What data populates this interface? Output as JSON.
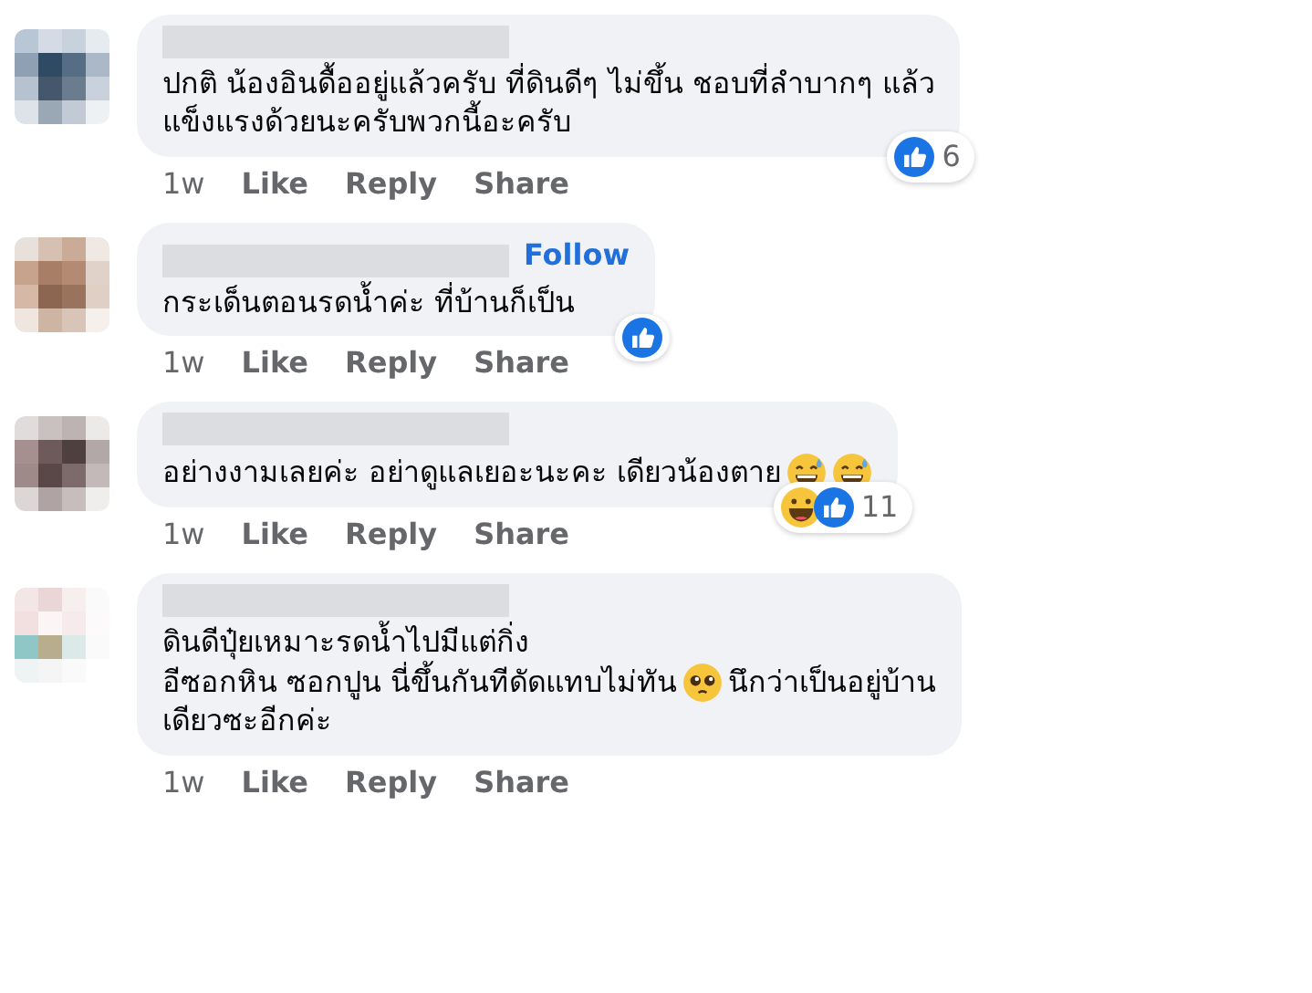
{
  "comments": [
    {
      "lines": [
        [
          {
            "kind": "text",
            "text": "ปกติ น้องอินดื้ออยู่แล้วครับ ที่ดินดีๆ ไม่ขึ้น ชอบที่ลำบากๆ แล้ว"
          }
        ],
        [
          {
            "kind": "text",
            "text": "แข็งแรงด้วยนะครับพวกนี้อะครับ"
          }
        ]
      ],
      "reactions": {
        "icons": [
          {
            "kind": "like"
          }
        ],
        "count": "6"
      },
      "time": "1w",
      "actions": [
        "Like",
        "Reply",
        "Share"
      ]
    },
    {
      "follow": "Follow",
      "lines": [
        [
          {
            "kind": "text",
            "text": "กระเด็นตอนรดน้ำค่ะ ที่บ้านก็เป็น"
          }
        ]
      ],
      "reactions": {
        "icons": [
          {
            "kind": "like"
          }
        ]
      },
      "time": "1w",
      "actions": [
        "Like",
        "Reply",
        "Share"
      ]
    },
    {
      "lines": [
        [
          {
            "kind": "text",
            "text": "อย่างงามเลยค่ะ อย่าดูแลเยอะนะคะ เดียวน้องตาย"
          },
          {
            "kind": "sweatsmile"
          },
          {
            "kind": "sweatsmile"
          }
        ]
      ],
      "reactions": {
        "icons": [
          {
            "kind": "haha"
          },
          {
            "kind": "like"
          }
        ],
        "count": "11"
      },
      "time": "1w",
      "actions": [
        "Like",
        "Reply",
        "Share"
      ]
    },
    {
      "lines": [
        [
          {
            "kind": "text",
            "text": "ดินดีปุ๋ยเหมาะรดน้ำไปมีแต่กิ่ง"
          }
        ],
        [
          {
            "kind": "text",
            "text": "อีซอกหิน ซอกปูน นี่ขึ้นกันทีดัดแทบไม่ทัน"
          },
          {
            "kind": "pleading"
          },
          {
            "kind": "text",
            "text": "นึกว่าเป็นอยู่บ้าน"
          }
        ],
        [
          {
            "kind": "text",
            "text": "เดียวซะอีกค่ะ"
          }
        ]
      ],
      "time": "1w",
      "actions": [
        "Like",
        "Reply",
        "Share"
      ]
    }
  ]
}
